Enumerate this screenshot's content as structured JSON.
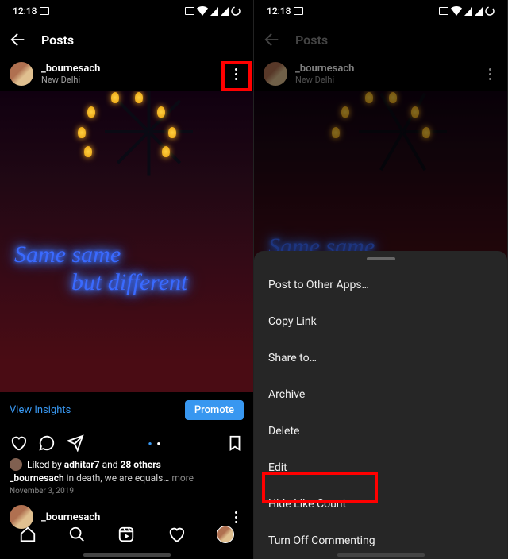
{
  "status": {
    "time": "12:18"
  },
  "page_title": "Posts",
  "post": {
    "username": "_bournesach",
    "location": "New Delhi",
    "view_insights": "View Insights",
    "promote": "Promote",
    "liked_prefix": "Liked by ",
    "liked_user": "adhitar7",
    "liked_and": " and ",
    "liked_others": "28 others",
    "caption_user": "_bournesach",
    "caption_text": " in death, we are equals… ",
    "more": "more",
    "date": "November 3, 2019"
  },
  "neon": {
    "line1": "Same same",
    "line2": "but different"
  },
  "sheet": {
    "items": [
      "Post to Other Apps…",
      "Copy Link",
      "Share to…",
      "Archive",
      "Delete",
      "Edit",
      "Hide Like Count",
      "Turn Off Commenting"
    ]
  }
}
